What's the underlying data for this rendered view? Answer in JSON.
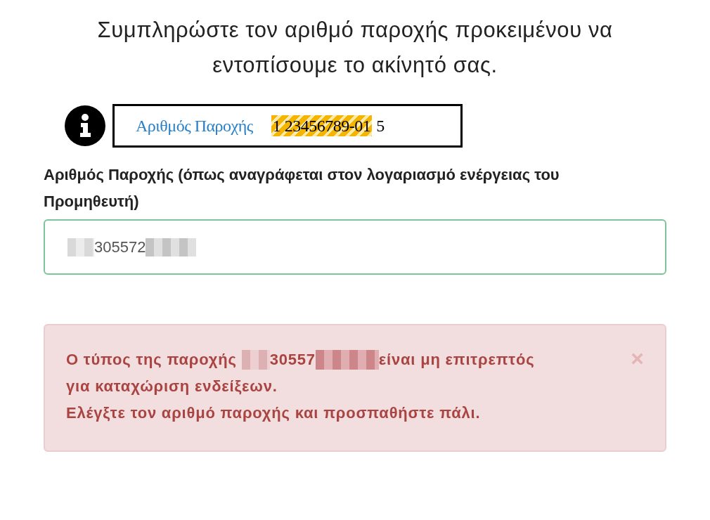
{
  "heading": "Συμπληρώστε τον αριθμό παροχής προκειμένου να εντοπίσουμε το ακίνητό σας.",
  "example": {
    "label": "Αριθμός Παροχής",
    "number": "1 23456789-01",
    "suffix": "5"
  },
  "field": {
    "label": "Αριθμός Παροχής (όπως αναγράφεται στον λογαριασμό ενέργειας του Προμηθευτή)",
    "value": "305572",
    "redacted": true
  },
  "alert": {
    "message_start": "Ο τύπος της παροχής",
    "message_number": "30557",
    "message_end": "είναι μη επιτρεπτός",
    "message_continuation": "για καταχώριση ενδείξεων.",
    "hint": "Ελέγξτε τον αριθμό παροχής και προσπαθήστε πάλι.",
    "dismiss": "×"
  }
}
